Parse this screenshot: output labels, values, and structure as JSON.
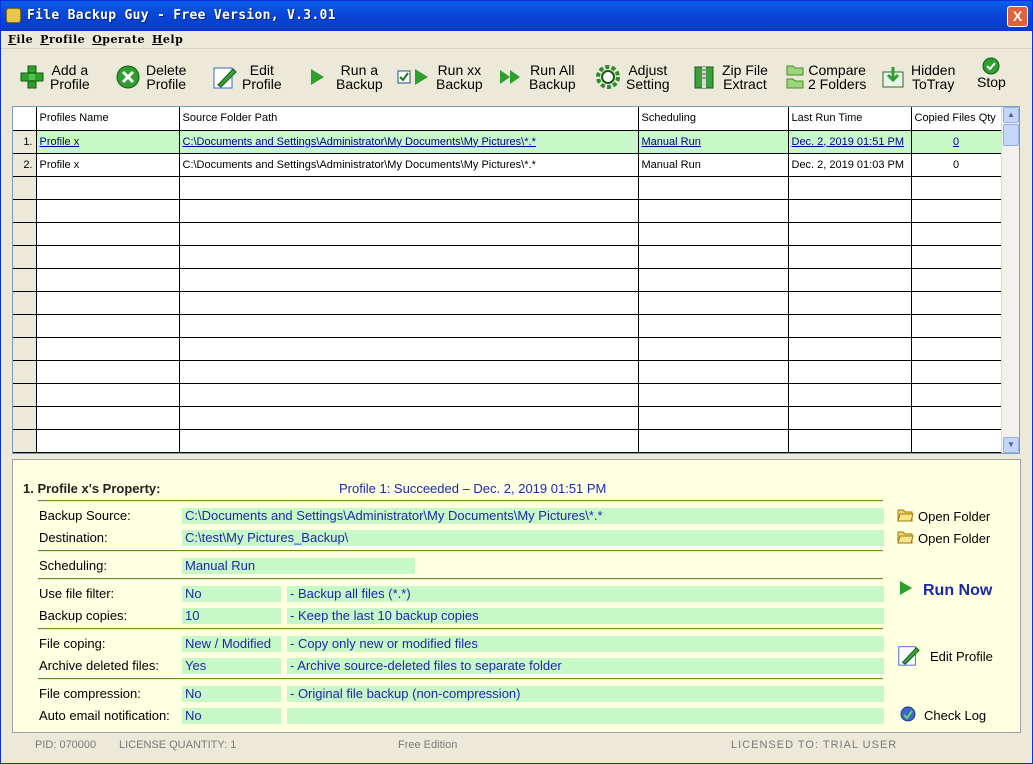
{
  "window": {
    "title": "File Backup Guy - Free Version, V.3.01",
    "close_glyph": "X"
  },
  "menu": [
    "File",
    "Profile",
    "Operate",
    "Help"
  ],
  "toolbar": [
    {
      "name": "add-profile",
      "icon": "add-plus-icon",
      "line1": "Add a",
      "line2": "Profile"
    },
    {
      "name": "delete-profile",
      "icon": "delete-x-icon",
      "line1": "Delete",
      "line2": "Profile"
    },
    {
      "name": "edit-profile",
      "icon": "edit-pencil-icon",
      "line1": "Edit",
      "line2": "Profile"
    },
    {
      "name": "run-backup",
      "icon": "play-icon",
      "line1": "Run a",
      "line2": "Backup"
    },
    {
      "name": "run-xx-backup",
      "icon": "check-play-icon",
      "line1": "Run xx",
      "line2": "Backup"
    },
    {
      "name": "run-all-backup",
      "icon": "fast-forward-icon",
      "line1": "Run All",
      "line2": "Backup"
    },
    {
      "name": "adjust-setting",
      "icon": "gear-icon",
      "line1": "Adjust",
      "line2": "Setting"
    },
    {
      "name": "zip-file-extract",
      "icon": "zip-icon",
      "line1": "Zip File",
      "line2": "Extract"
    },
    {
      "name": "compare-folders",
      "icon": "folders-icon",
      "line1": "Compare",
      "line2": "2 Folders"
    },
    {
      "name": "hidden-to-tray",
      "icon": "tray-icon",
      "line1": "Hidden",
      "line2": "ToTray"
    },
    {
      "name": "stop",
      "icon": "stop-icon",
      "line1": "",
      "line2": "Stop"
    }
  ],
  "table": {
    "headers": [
      "",
      "Profiles Name",
      "Source Folder Path",
      "Scheduling",
      "Last Run Time",
      "Copied Files Qty"
    ],
    "rows": [
      {
        "num": "1.",
        "name": "Profile x",
        "source": "C:\\Documents and Settings\\Administrator\\My Documents\\My Pictures\\*.*",
        "scheduling": "Manual Run",
        "last_run": "Dec. 2, 2019 01:51 PM",
        "qty": "0",
        "selected": true
      },
      {
        "num": "2.",
        "name": "Profile x",
        "source": "C:\\Documents and Settings\\Administrator\\My Documents\\My Pictures\\*.*",
        "scheduling": "Manual Run",
        "last_run": "Dec. 2, 2019 01:03 PM",
        "qty": "0",
        "selected": false
      }
    ],
    "empty_rows": 12
  },
  "property": {
    "title": "1. Profile x's Property:",
    "status": "Profile 1: Succeeded – Dec. 2, 2019 01:51 PM",
    "backup_source_label": "Backup Source:",
    "backup_source_value": "C:\\Documents and Settings\\Administrator\\My Documents\\My Pictures\\*.*",
    "destination_label": "Destination:",
    "destination_value": "C:\\test\\My Pictures_Backup\\",
    "scheduling_label": "Scheduling:",
    "scheduling_value": "Manual Run",
    "file_filter_label": "Use file filter:",
    "file_filter_value": "No",
    "file_filter_desc": "-  Backup all files (*.*)",
    "backup_copies_label": "Backup copies:",
    "backup_copies_value": "10",
    "backup_copies_desc": "-  Keep the last 10 backup copies",
    "file_coping_label": "File coping:",
    "file_coping_value": "New / Modified",
    "file_coping_desc": "-  Copy only new or modified files",
    "archive_label": "Archive deleted files:",
    "archive_value": "Yes",
    "archive_desc": "-  Archive source-deleted files to separate folder",
    "compression_label": "File compression:",
    "compression_value": "No",
    "compression_desc": "-  Original file backup (non-compression)",
    "email_label": "Auto email notification:",
    "email_value": "No",
    "email_desc": "",
    "open_folder_1": "Open Folder",
    "open_folder_2": "Open Folder",
    "run_now": "Run Now",
    "edit_profile": "Edit Profile",
    "check_log": "Check Log"
  },
  "status": {
    "pid": "PID:  070000",
    "license_qty": "LICENSE QUANTITY:  1",
    "edition": "Free Edition",
    "licensed_to": "LICENSED  TO:  TRIAL  USER"
  },
  "colors": {
    "accent_green": "#c8f7c8",
    "value_text": "#1a2aa8",
    "title_blue": "#0a5fe8"
  }
}
